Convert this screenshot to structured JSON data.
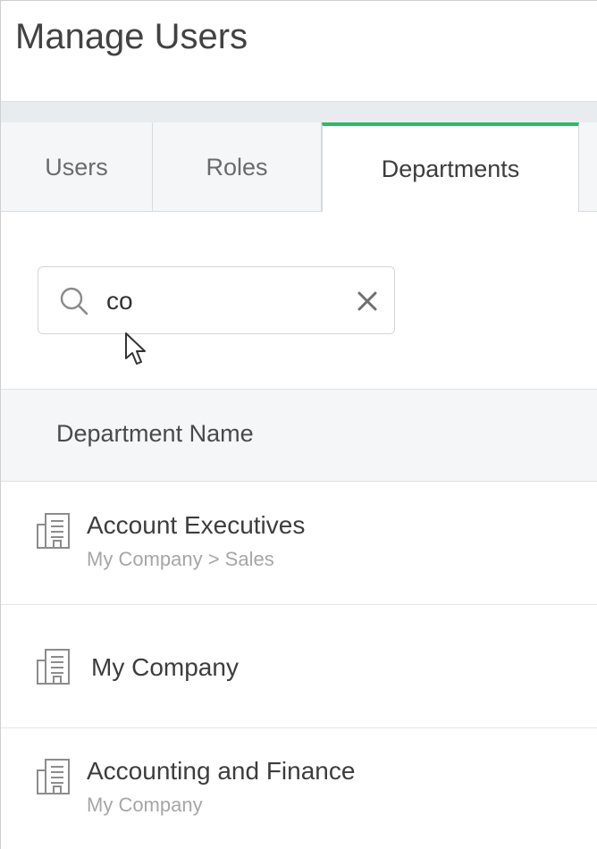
{
  "page": {
    "title": "Manage Users"
  },
  "tabs": [
    {
      "label": "Users"
    },
    {
      "label": "Roles"
    },
    {
      "label": "Departments",
      "active": true
    }
  ],
  "search": {
    "value": "co",
    "placeholder": ""
  },
  "table": {
    "column_header": "Department Name",
    "rows": [
      {
        "name": "Account Executives",
        "path": "My Company > Sales"
      },
      {
        "name": "My Company",
        "path": ""
      },
      {
        "name": "Accounting and Finance",
        "path": "My Company"
      }
    ]
  },
  "icons": {
    "search": "search-icon",
    "clear": "close-icon",
    "department": "building-icon",
    "cursor": "mouse-pointer-icon"
  },
  "colors": {
    "active_tab_accent": "#2fb86a",
    "header_background": "#f4f6f8",
    "secondary_text": "#a6a6a6"
  }
}
